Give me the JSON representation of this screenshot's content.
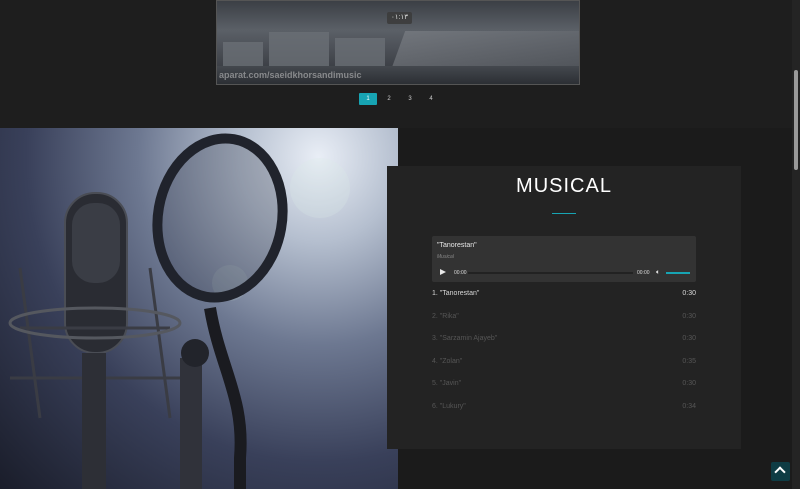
{
  "video": {
    "duration": "۰۱:۱۳",
    "watermark": "aparat.com/saeidkhorsandimusic"
  },
  "pagination": {
    "pages": [
      "1",
      "2",
      "3",
      "4"
    ],
    "active": "1"
  },
  "section": {
    "title": "MUSICAL"
  },
  "player": {
    "now_playing": "\"Tanorestan\"",
    "album": "Musical",
    "current_time": "00:00",
    "total_time": "00:00",
    "accent_color": "#17a4b3"
  },
  "tracks": [
    {
      "name": "1. \"Tanorestan\"",
      "duration": "0:30"
    },
    {
      "name": "2. \"Rika\"",
      "duration": "0:30"
    },
    {
      "name": "3. \"Sarzamin Ajayeb\"",
      "duration": "0:30"
    },
    {
      "name": "4. \"Zolan\"",
      "duration": "0:35"
    },
    {
      "name": "5. \"Javin\"",
      "duration": "0:30"
    },
    {
      "name": "6. \"Lukury\"",
      "duration": "0:34"
    }
  ],
  "icons": {
    "play": "play-icon",
    "volume": "volume-icon",
    "back_to_top": "chevron-up-icon"
  }
}
